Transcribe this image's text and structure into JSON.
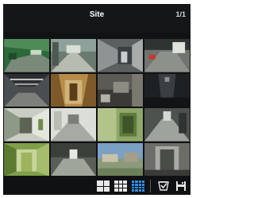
{
  "header": {
    "title": "Site",
    "page_indicator": "1/1"
  },
  "grid": {
    "layout": "4x4",
    "camera_tiles": [
      {
        "view": "green-room"
      },
      {
        "view": "lobby-glass"
      },
      {
        "view": "corridor-door"
      },
      {
        "view": "parking-lot"
      },
      {
        "view": "garage-ceiling"
      },
      {
        "view": "stairwell-warm"
      },
      {
        "view": "office-desk"
      },
      {
        "view": "dark-hallway"
      },
      {
        "view": "bright-corridor"
      },
      {
        "view": "white-corridor"
      },
      {
        "view": "green-wall"
      },
      {
        "view": "elevator-hall"
      },
      {
        "view": "green-door"
      },
      {
        "view": "lobby-floor"
      },
      {
        "view": "outdoor-yard"
      },
      {
        "view": "entrance-door"
      }
    ]
  },
  "toolbar": {
    "buttons": [
      {
        "icon": "grid-2x2-icon",
        "active": false
      },
      {
        "icon": "grid-3x3-icon",
        "active": false
      },
      {
        "icon": "grid-4x4-icon",
        "active": true
      },
      {
        "icon": "check-shield-icon"
      },
      {
        "icon": "save-icon"
      }
    ],
    "active_color": "#2f8fe6"
  }
}
